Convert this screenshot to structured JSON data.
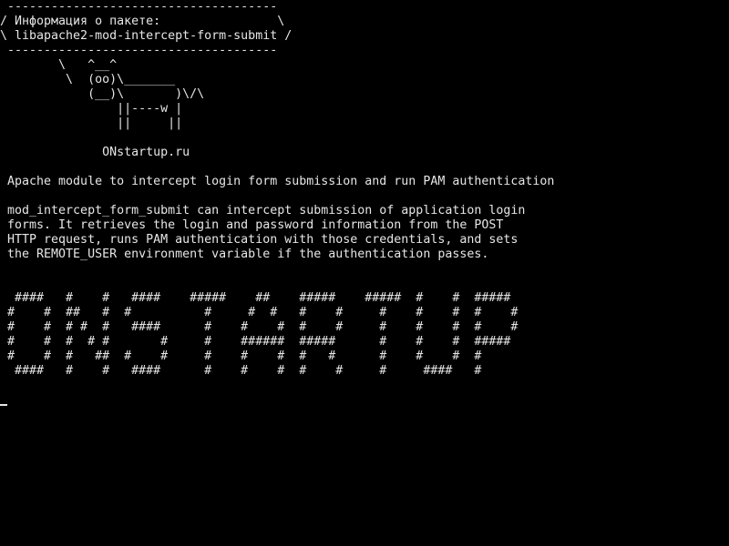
{
  "terminal": {
    "lines": [
      " -------------------------------------",
      "/ Информация о пакете:                \\",
      "\\ libapache2-mod-intercept-form-submit /",
      " -------------------------------------",
      "        \\   ^__^",
      "         \\  (oo)\\_______",
      "            (__)\\       )\\/\\",
      "                ||----w |",
      "                ||     ||",
      "",
      "              ONstartup.ru",
      "",
      " Apache module to intercept login form submission and run PAM authentication",
      "",
      " mod_intercept_form_submit can intercept submission of application login",
      " forms. It retrieves the login and password information from the POST",
      " HTTP request, runs PAM authentication with those credentials, and sets",
      " the REMOTE_USER environment variable if the authentication passes.",
      "",
      "",
      "  ####   #    #   ####    #####    ##    #####    #####  #    #  #####",
      " #    #  ##   #  #          #     #  #   #    #     #    #    #  #    #",
      " #    #  # #  #   ####      #    #    #  #    #     #    #    #  #    #",
      " #    #  #  # #       #     #    ######  #####      #    #    #  #####",
      " #    #  #   ##  #    #     #    #    #  #   #      #    #    #  #",
      "  ####   #    #   ####      #    #    #  #    #     #     ####   #"
    ],
    "cursor_visible": true
  }
}
